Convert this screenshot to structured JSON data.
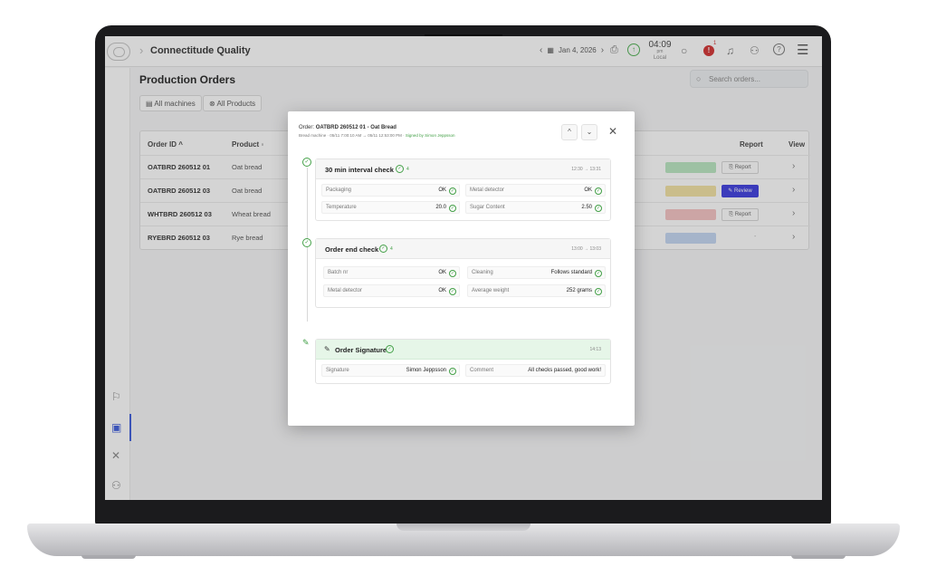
{
  "app": {
    "title": "Connectitude Quality"
  },
  "topbar": {
    "date": "Jan 4, 2026",
    "time": "04:09",
    "ampm": "pm",
    "timezone": "Local",
    "alert_count": "1"
  },
  "page": {
    "title": "Production Orders",
    "search_placeholder": "Search orders...",
    "filters": [
      {
        "label": "All machines"
      },
      {
        "label": "All Products"
      }
    ]
  },
  "table": {
    "headers": {
      "order_id": "Order ID",
      "product": "Product",
      "report": "Report",
      "view": "View"
    },
    "rows": [
      {
        "order_id": "OATBRD 260512 01",
        "product": "Oat bread",
        "status_color": "#b9e7c0",
        "report": "Report"
      },
      {
        "order_id": "OATBRD 260512 03",
        "product": "Oat bread",
        "status_color": "#f3e2a2",
        "report": "Review"
      },
      {
        "order_id": "WHTBRD 260512 03",
        "product": "Wheat bread",
        "status_color": "#f5c3c3",
        "report": "Report"
      },
      {
        "order_id": "RYEBRD 260512 03",
        "product": "Rye bread",
        "status_color": "#c3d6f3",
        "report": "-"
      }
    ]
  },
  "modal": {
    "order_prefix": "Order:",
    "order_id": "OATBRD 260512 01",
    "order_product": "- Oat Bread",
    "subline": "Bread machine · 05/11 7:00:10 AM → 05/11 12:53:00 PM ·",
    "signed_by": "Signed by Simon Jeppsson",
    "cards": [
      {
        "title": "30 min interval check",
        "count": "4",
        "time": "12:30 → 13:31",
        "fields": [
          {
            "label": "Packaging",
            "value": "OK"
          },
          {
            "label": "Metal detector",
            "value": "OK"
          },
          {
            "label": "Temperature",
            "value": "20.0"
          },
          {
            "label": "Sugar Content",
            "value": "2.50"
          }
        ]
      },
      {
        "title": "Order end check",
        "count": "4",
        "time": "13:00 → 13:03",
        "fields": [
          {
            "label": "Batch nr",
            "value": "OK"
          },
          {
            "label": "Cleaning",
            "value": "Follows standard"
          },
          {
            "label": "Metal detector",
            "value": "OK"
          },
          {
            "label": "Average weight",
            "value": "252 grams"
          }
        ]
      }
    ],
    "signature": {
      "title": "Order Signature",
      "time": "14:13",
      "fields": [
        {
          "label": "Signature",
          "value": "Simon Jeppsson"
        },
        {
          "label": "Comment",
          "value": "All checks passed, good work!"
        }
      ]
    }
  },
  "colors": {
    "accent": "#3b3bdf",
    "success": "#43a047",
    "alert": "#d32f2f"
  }
}
